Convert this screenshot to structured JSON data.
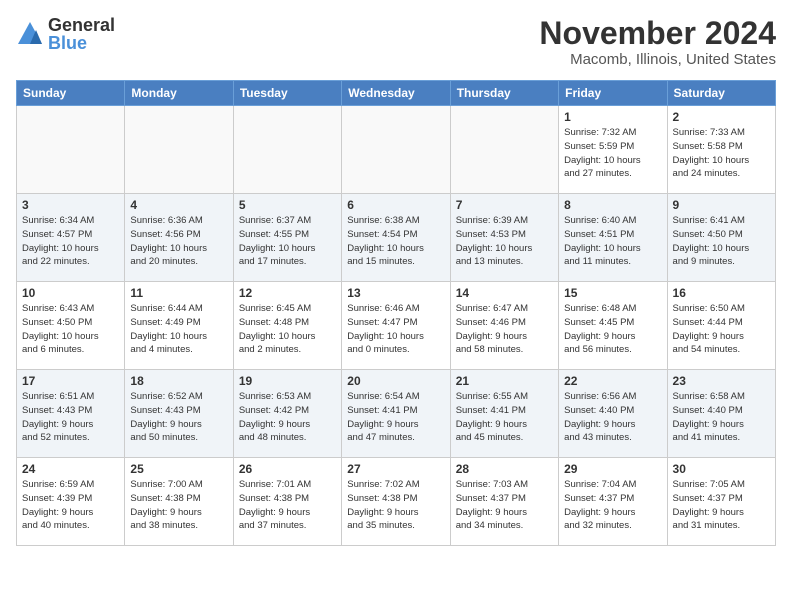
{
  "logo": {
    "general": "General",
    "blue": "Blue"
  },
  "title": "November 2024",
  "location": "Macomb, Illinois, United States",
  "headers": [
    "Sunday",
    "Monday",
    "Tuesday",
    "Wednesday",
    "Thursday",
    "Friday",
    "Saturday"
  ],
  "weeks": [
    [
      {
        "day": "",
        "info": ""
      },
      {
        "day": "",
        "info": ""
      },
      {
        "day": "",
        "info": ""
      },
      {
        "day": "",
        "info": ""
      },
      {
        "day": "",
        "info": ""
      },
      {
        "day": "1",
        "info": "Sunrise: 7:32 AM\nSunset: 5:59 PM\nDaylight: 10 hours\nand 27 minutes."
      },
      {
        "day": "2",
        "info": "Sunrise: 7:33 AM\nSunset: 5:58 PM\nDaylight: 10 hours\nand 24 minutes."
      }
    ],
    [
      {
        "day": "3",
        "info": "Sunrise: 6:34 AM\nSunset: 4:57 PM\nDaylight: 10 hours\nand 22 minutes."
      },
      {
        "day": "4",
        "info": "Sunrise: 6:36 AM\nSunset: 4:56 PM\nDaylight: 10 hours\nand 20 minutes."
      },
      {
        "day": "5",
        "info": "Sunrise: 6:37 AM\nSunset: 4:55 PM\nDaylight: 10 hours\nand 17 minutes."
      },
      {
        "day": "6",
        "info": "Sunrise: 6:38 AM\nSunset: 4:54 PM\nDaylight: 10 hours\nand 15 minutes."
      },
      {
        "day": "7",
        "info": "Sunrise: 6:39 AM\nSunset: 4:53 PM\nDaylight: 10 hours\nand 13 minutes."
      },
      {
        "day": "8",
        "info": "Sunrise: 6:40 AM\nSunset: 4:51 PM\nDaylight: 10 hours\nand 11 minutes."
      },
      {
        "day": "9",
        "info": "Sunrise: 6:41 AM\nSunset: 4:50 PM\nDaylight: 10 hours\nand 9 minutes."
      }
    ],
    [
      {
        "day": "10",
        "info": "Sunrise: 6:43 AM\nSunset: 4:50 PM\nDaylight: 10 hours\nand 6 minutes."
      },
      {
        "day": "11",
        "info": "Sunrise: 6:44 AM\nSunset: 4:49 PM\nDaylight: 10 hours\nand 4 minutes."
      },
      {
        "day": "12",
        "info": "Sunrise: 6:45 AM\nSunset: 4:48 PM\nDaylight: 10 hours\nand 2 minutes."
      },
      {
        "day": "13",
        "info": "Sunrise: 6:46 AM\nSunset: 4:47 PM\nDaylight: 10 hours\nand 0 minutes."
      },
      {
        "day": "14",
        "info": "Sunrise: 6:47 AM\nSunset: 4:46 PM\nDaylight: 9 hours\nand 58 minutes."
      },
      {
        "day": "15",
        "info": "Sunrise: 6:48 AM\nSunset: 4:45 PM\nDaylight: 9 hours\nand 56 minutes."
      },
      {
        "day": "16",
        "info": "Sunrise: 6:50 AM\nSunset: 4:44 PM\nDaylight: 9 hours\nand 54 minutes."
      }
    ],
    [
      {
        "day": "17",
        "info": "Sunrise: 6:51 AM\nSunset: 4:43 PM\nDaylight: 9 hours\nand 52 minutes."
      },
      {
        "day": "18",
        "info": "Sunrise: 6:52 AM\nSunset: 4:43 PM\nDaylight: 9 hours\nand 50 minutes."
      },
      {
        "day": "19",
        "info": "Sunrise: 6:53 AM\nSunset: 4:42 PM\nDaylight: 9 hours\nand 48 minutes."
      },
      {
        "day": "20",
        "info": "Sunrise: 6:54 AM\nSunset: 4:41 PM\nDaylight: 9 hours\nand 47 minutes."
      },
      {
        "day": "21",
        "info": "Sunrise: 6:55 AM\nSunset: 4:41 PM\nDaylight: 9 hours\nand 45 minutes."
      },
      {
        "day": "22",
        "info": "Sunrise: 6:56 AM\nSunset: 4:40 PM\nDaylight: 9 hours\nand 43 minutes."
      },
      {
        "day": "23",
        "info": "Sunrise: 6:58 AM\nSunset: 4:40 PM\nDaylight: 9 hours\nand 41 minutes."
      }
    ],
    [
      {
        "day": "24",
        "info": "Sunrise: 6:59 AM\nSunset: 4:39 PM\nDaylight: 9 hours\nand 40 minutes."
      },
      {
        "day": "25",
        "info": "Sunrise: 7:00 AM\nSunset: 4:38 PM\nDaylight: 9 hours\nand 38 minutes."
      },
      {
        "day": "26",
        "info": "Sunrise: 7:01 AM\nSunset: 4:38 PM\nDaylight: 9 hours\nand 37 minutes."
      },
      {
        "day": "27",
        "info": "Sunrise: 7:02 AM\nSunset: 4:38 PM\nDaylight: 9 hours\nand 35 minutes."
      },
      {
        "day": "28",
        "info": "Sunrise: 7:03 AM\nSunset: 4:37 PM\nDaylight: 9 hours\nand 34 minutes."
      },
      {
        "day": "29",
        "info": "Sunrise: 7:04 AM\nSunset: 4:37 PM\nDaylight: 9 hours\nand 32 minutes."
      },
      {
        "day": "30",
        "info": "Sunrise: 7:05 AM\nSunset: 4:37 PM\nDaylight: 9 hours\nand 31 minutes."
      }
    ]
  ]
}
